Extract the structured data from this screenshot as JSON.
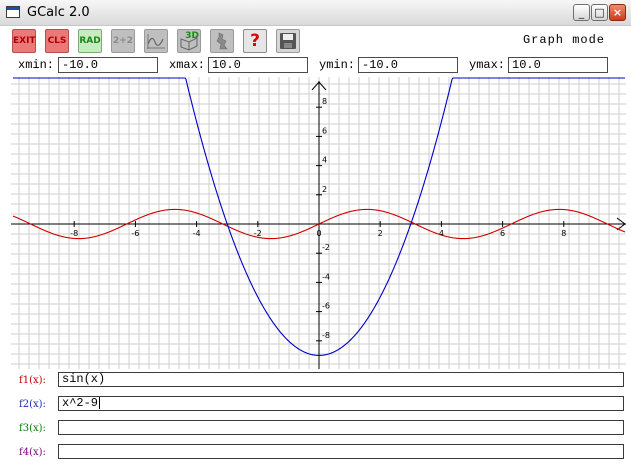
{
  "window": {
    "title": "GCalc 2.0",
    "controls": [
      "_",
      "□",
      "×"
    ]
  },
  "toolbar": {
    "buttons": [
      {
        "label": "EXIT",
        "icon": "exit-icon"
      },
      {
        "label": "CLS",
        "icon": "cls-icon"
      },
      {
        "label": "RAD",
        "icon": "rad-icon"
      },
      {
        "label": "2+2",
        "icon": "calculator-icon"
      },
      {
        "label": "",
        "icon": "graph-analysis-icon"
      },
      {
        "label": "3D",
        "icon": "3d-graph-icon"
      },
      {
        "label": "",
        "icon": "map-icon"
      },
      {
        "label": "?",
        "icon": "help-icon"
      },
      {
        "label": "",
        "icon": "save-icon"
      }
    ],
    "mode_label": "Graph mode"
  },
  "ranges": {
    "xmin_label": "xmin:",
    "xmin_value": "-10.0",
    "xmax_label": "xmax:",
    "xmax_value": "10.0",
    "ymin_label": "ymin:",
    "ymin_value": "-10.0",
    "ymax_label": "ymax:",
    "ymax_value": "10.0"
  },
  "chart_data": {
    "type": "line",
    "xlim": [
      -10,
      10
    ],
    "ylim": [
      -10,
      10
    ],
    "grid": true,
    "x_ticks": [
      "-8",
      "-6",
      "-4",
      "-2",
      "0",
      "2",
      "4",
      "6",
      "8"
    ],
    "y_ticks": [
      "8",
      "6",
      "4",
      "2",
      "-2",
      "-4",
      "-6",
      "-8"
    ],
    "series": [
      {
        "name": "sin(x)",
        "color": "#d00000"
      },
      {
        "name": "x^2-9",
        "color": "#0000cc"
      }
    ]
  },
  "functions": [
    {
      "label": "f1(x):",
      "value": "sin(x)",
      "color": "#c00000"
    },
    {
      "label": "f2(x):",
      "value": "x^2-9",
      "color": "#1a2fb0"
    },
    {
      "label": "f3(x):",
      "value": "",
      "color": "#0a7a0a"
    },
    {
      "label": "f4(x):",
      "value": "",
      "color": "#7a007a"
    }
  ]
}
